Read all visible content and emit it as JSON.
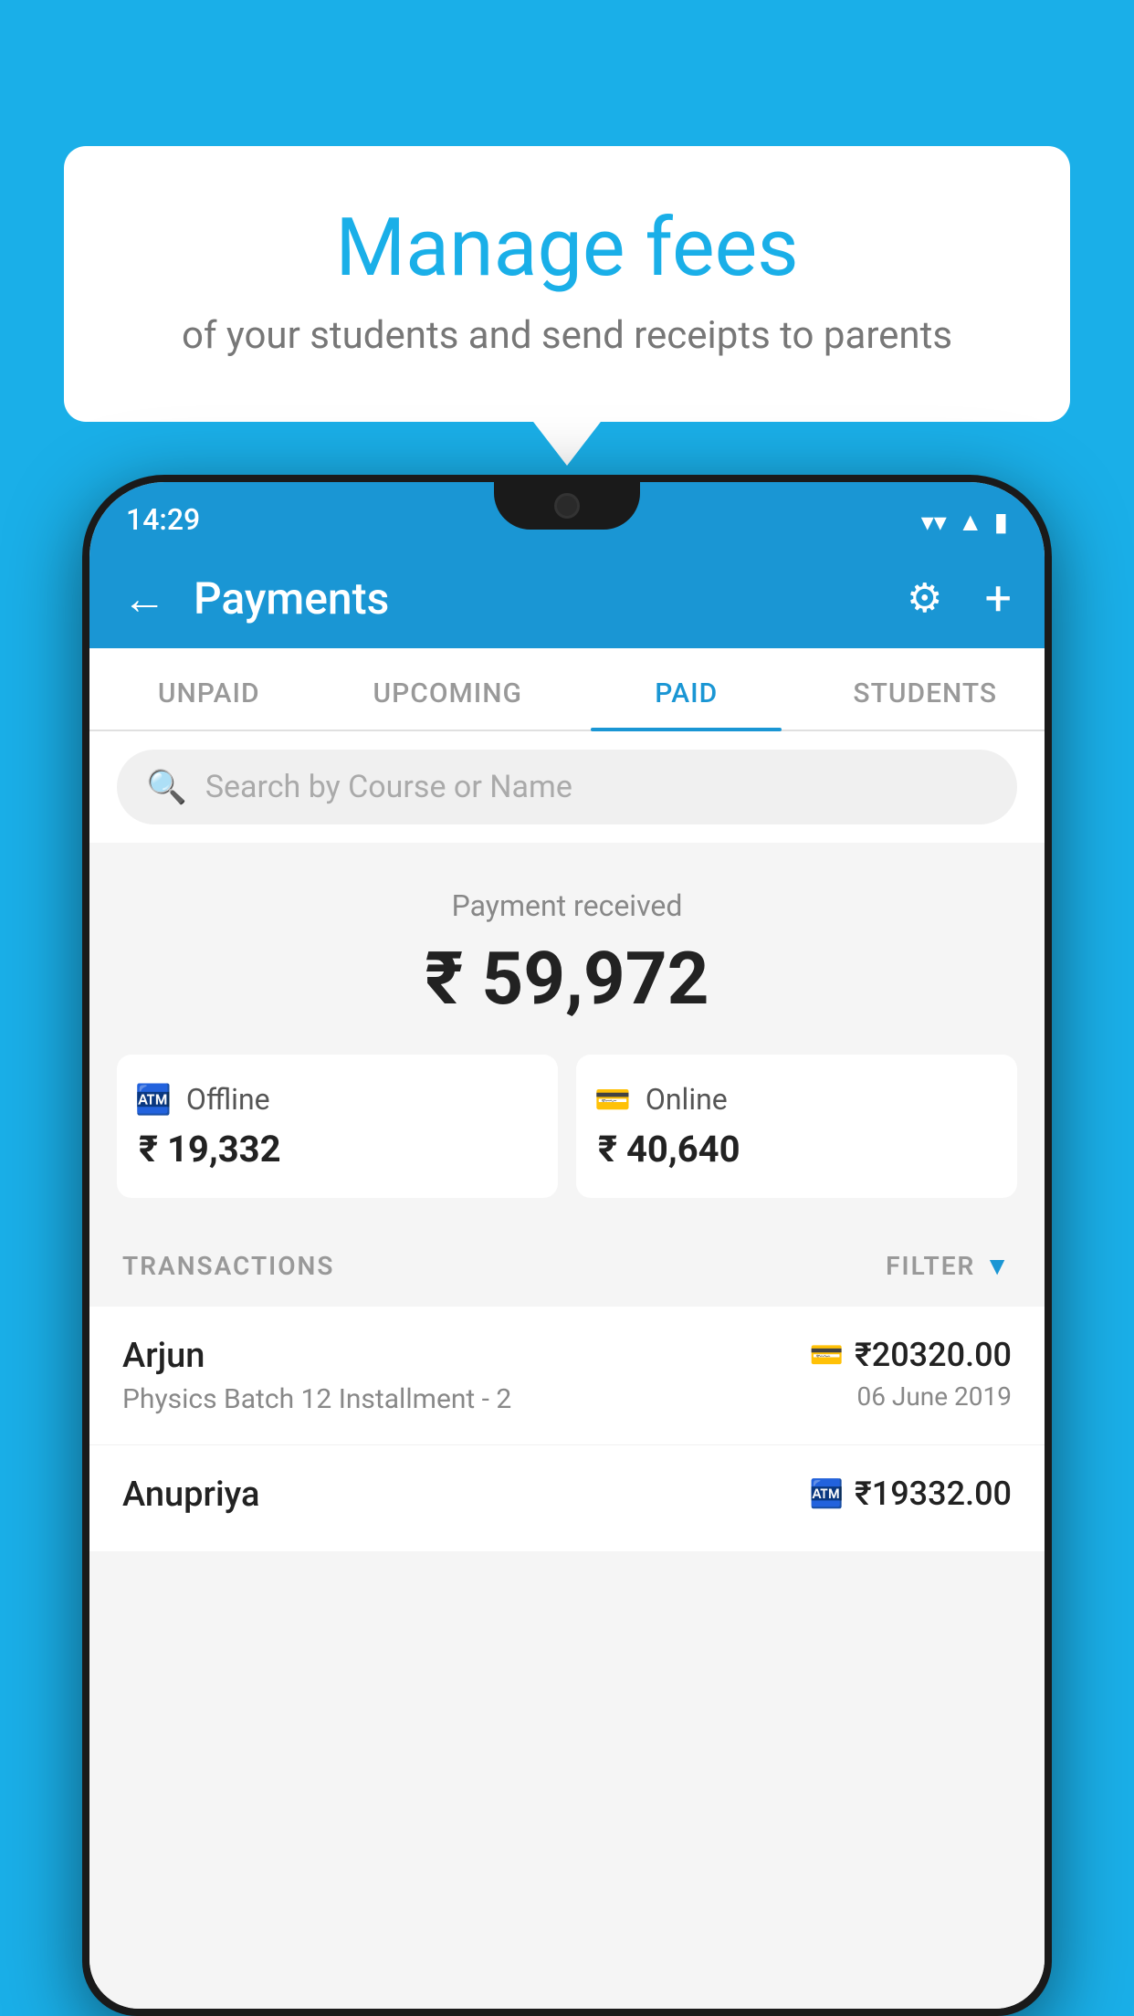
{
  "background_color": "#1AAFE8",
  "speech_bubble": {
    "title": "Manage fees",
    "subtitle": "of your students and send receipts to parents"
  },
  "status_bar": {
    "time": "14:29",
    "wifi_icon": "wifi",
    "signal_icon": "signal",
    "battery_icon": "battery"
  },
  "app_bar": {
    "title": "Payments",
    "back_label": "←",
    "gear_label": "⚙",
    "plus_label": "+"
  },
  "tabs": [
    {
      "id": "unpaid",
      "label": "UNPAID",
      "active": false
    },
    {
      "id": "upcoming",
      "label": "UPCOMING",
      "active": false
    },
    {
      "id": "paid",
      "label": "PAID",
      "active": true
    },
    {
      "id": "students",
      "label": "STUDENTS",
      "active": false
    }
  ],
  "search": {
    "placeholder": "Search by Course or Name",
    "search_icon": "🔍"
  },
  "payment_summary": {
    "label": "Payment received",
    "total_amount": "₹ 59,972",
    "offline": {
      "type": "Offline",
      "amount": "₹ 19,332"
    },
    "online": {
      "type": "Online",
      "amount": "₹ 40,640"
    }
  },
  "transactions_section": {
    "label": "TRANSACTIONS",
    "filter_label": "FILTER"
  },
  "transactions": [
    {
      "name": "Arjun",
      "course": "Physics Batch 12 Installment - 2",
      "payment_type": "online",
      "amount": "₹20320.00",
      "date": "06 June 2019"
    },
    {
      "name": "Anupriya",
      "course": "",
      "payment_type": "offline",
      "amount": "₹19332.00",
      "date": ""
    }
  ]
}
